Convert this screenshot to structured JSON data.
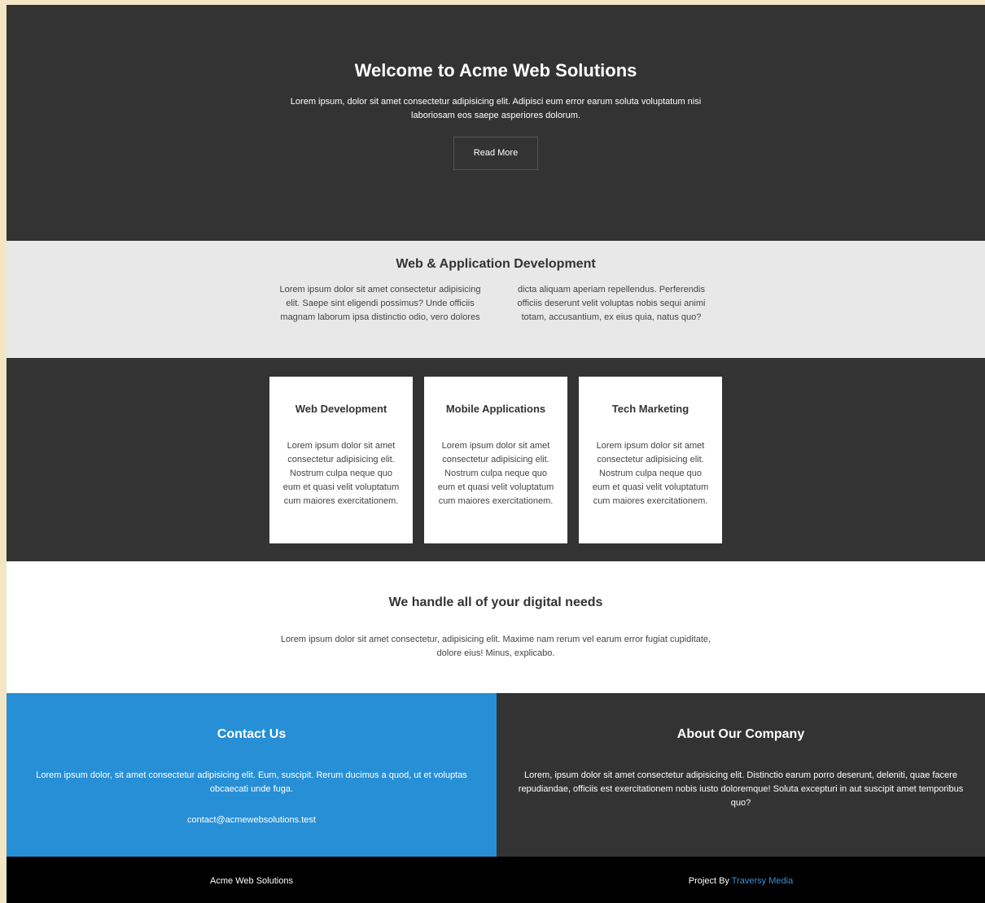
{
  "hero": {
    "title": "Welcome to Acme Web Solutions",
    "text": "Lorem ipsum, dolor sit amet consectetur adipisicing elit. Adipisci eum error earum soluta voluptatum nisi laboriosam eos saepe asperiores dolorum.",
    "button_label": "Read More"
  },
  "dev": {
    "title": "Web & Application Development",
    "text": "Lorem ipsum dolor sit amet consectetur adipisicing elit. Saepe sint eligendi possimus? Unde officiis magnam laborum ipsa distinctio odio, vero dolores dicta aliquam aperiam repellendus. Perferendis officiis deserunt velit voluptas nobis sequi animi totam, accusantium, ex eius quia, natus quo?"
  },
  "boxes": [
    {
      "title": "Web Development",
      "text": "Lorem ipsum dolor sit amet consectetur adipisicing elit. Nostrum culpa neque quo eum et quasi velit voluptatum cum maiores exercitationem."
    },
    {
      "title": "Mobile Applications",
      "text": "Lorem ipsum dolor sit amet consectetur adipisicing elit. Nostrum culpa neque quo eum et quasi velit voluptatum cum maiores exercitationem."
    },
    {
      "title": "Tech Marketing",
      "text": "Lorem ipsum dolor sit amet consectetur adipisicing elit. Nostrum culpa neque quo eum et quasi velit voluptatum cum maiores exercitationem."
    }
  ],
  "needs": {
    "title": "We handle all of your digital needs",
    "text": "Lorem ipsum dolor sit amet consectetur, adipisicing elit. Maxime nam rerum vel earum error fugiat cupiditate, dolore eius! Minus, explicabo."
  },
  "contact": {
    "title": "Contact Us",
    "text": "Lorem ipsum dolor, sit amet consectetur adipisicing elit. Eum, suscipit. Rerum ducimus a quod, ut et voluptas obcaecati unde fuga.",
    "email": "contact@acmewebsolutions.test"
  },
  "about": {
    "title": "About Our Company",
    "text": "Lorem, ipsum dolor sit amet consectetur adipisicing elit. Distinctio earum porro deserunt, deleniti, quae facere repudiandae, officiis est exercitationem nobis iusto doloremque! Soluta excepturi in aut suscipit amet temporibus quo?"
  },
  "footer": {
    "brand": "Acme Web Solutions",
    "project_prefix": "Project By",
    "project_link": "Traversy Media"
  },
  "colors": {
    "dark": "#333333",
    "light_gray": "#e8e8e8",
    "accent_blue": "#278fd6",
    "link_blue": "#3b8fd9",
    "footer_black": "#000000"
  }
}
